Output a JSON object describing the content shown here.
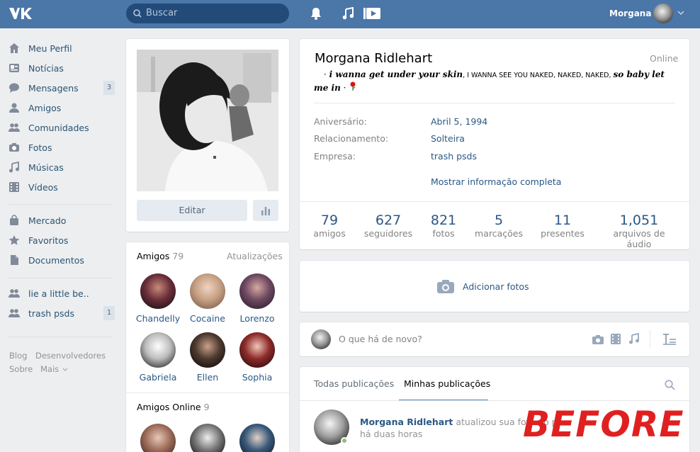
{
  "header": {
    "search_placeholder": "Buscar",
    "username": "Morgana"
  },
  "sidebar": {
    "items": [
      {
        "label": "Meu Perfil",
        "icon": "home-icon"
      },
      {
        "label": "Notícias",
        "icon": "news-icon"
      },
      {
        "label": "Mensagens",
        "icon": "messages-icon",
        "badge": "3"
      },
      {
        "label": "Amigos",
        "icon": "friends-icon"
      },
      {
        "label": "Comunidades",
        "icon": "groups-icon"
      },
      {
        "label": "Fotos",
        "icon": "camera-icon"
      },
      {
        "label": "Músicas",
        "icon": "music-icon"
      },
      {
        "label": "Vídeos",
        "icon": "video-icon"
      },
      {
        "label": "Mercado",
        "icon": "bag-icon"
      },
      {
        "label": "Favoritos",
        "icon": "star-icon"
      },
      {
        "label": "Documentos",
        "icon": "document-icon"
      },
      {
        "label": "lie a little be..",
        "icon": "community-icon"
      },
      {
        "label": "trash psds",
        "icon": "community-icon",
        "badge": "1"
      }
    ],
    "footer": {
      "blog": "Blog",
      "dev": "Desenvolvedores",
      "about": "Sobre",
      "more": "Mais"
    }
  },
  "profile": {
    "edit_label": "Editar",
    "friends": {
      "title": "Amigos",
      "count": "79",
      "updates": "Atualizações",
      "list": [
        "Chandelly",
        "Cocaine",
        "Lorenzo",
        "Gabriela",
        "Ellen",
        "Sophia"
      ]
    },
    "online_friends": {
      "title": "Amigos Online",
      "count": "9"
    }
  },
  "info": {
    "name": "Morgana Ridlehart",
    "online": "Online",
    "status_prefix": "· ",
    "status_italic1": "i wanna get under your skin",
    "status_caps": ", I WANNA SEE YOU NAKED, NAKED, NAKED, ",
    "status_italic2": "so baby let me in",
    "status_suffix": " · ",
    "rows": [
      {
        "label": "Aniversário:",
        "value": "Abril 5, 1994"
      },
      {
        "label": "Relacionamento:",
        "value": "Solteira"
      },
      {
        "label": "Empresa:",
        "value": "trash psds"
      }
    ],
    "show_more": "Mostrar informação completa",
    "stats": [
      {
        "n": "79",
        "l": "amigos"
      },
      {
        "n": "627",
        "l": "seguidores"
      },
      {
        "n": "821",
        "l": "fotos"
      },
      {
        "n": "5",
        "l": "marcações"
      },
      {
        "n": "11",
        "l": "presentes"
      },
      {
        "n": "1,051",
        "l": "arquivos de áudio"
      }
    ]
  },
  "add_photos": "Adicionar fotos",
  "composer_placeholder": "O que há de novo?",
  "tabs": {
    "all": "Todas publicações",
    "mine": "Minhas publicações"
  },
  "post": {
    "author": "Morgana Ridlehart",
    "action": "atualizou sua foto do p",
    "time": "há duas horas"
  },
  "watermark": "BEFORE",
  "colors": {
    "header": "#4a76a8",
    "link": "#2a5885",
    "background": "#edeef0"
  }
}
